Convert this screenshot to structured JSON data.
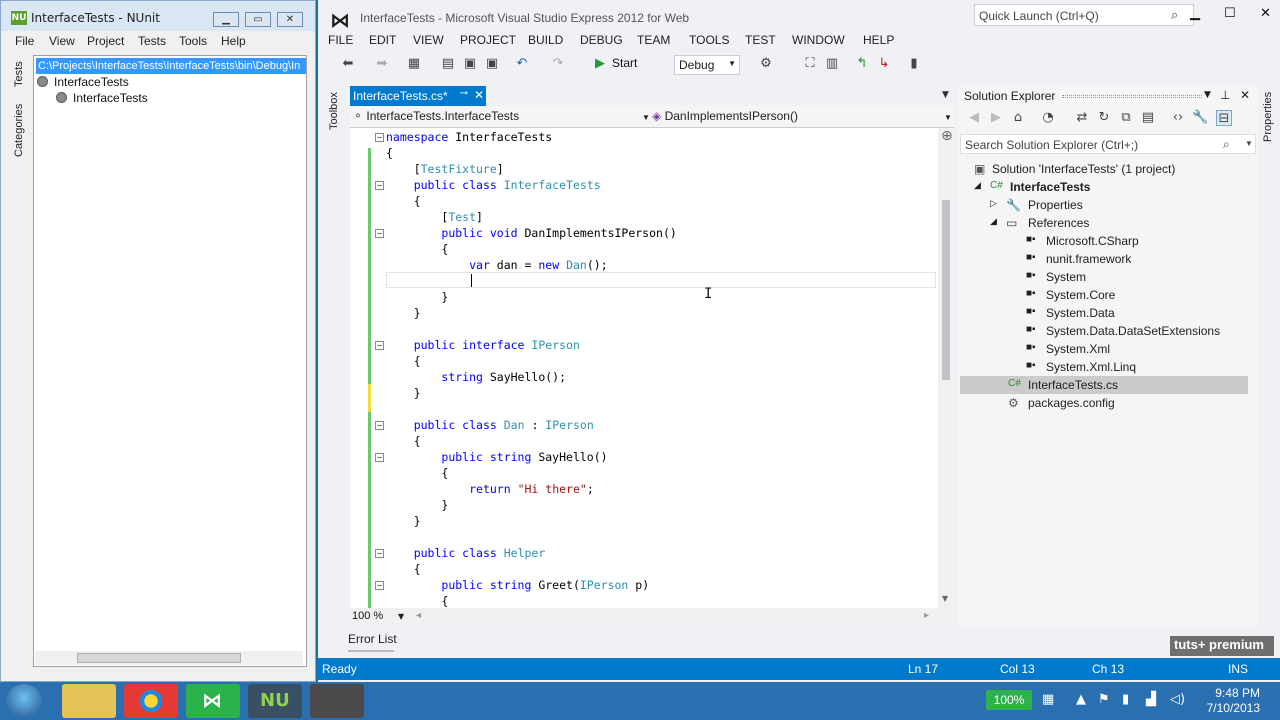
{
  "nunit": {
    "title": "InterfaceTests - NUnit",
    "logo": "NU",
    "menu": [
      "File",
      "View",
      "Project",
      "Tests",
      "Tools",
      "Help"
    ],
    "side_tabs": [
      "Tests",
      "Categories"
    ],
    "path": "C:\\Projects\\InterfaceTests\\InterfaceTests\\bin\\Debug\\In",
    "tree": [
      "InterfaceTests",
      "InterfaceTests"
    ]
  },
  "vs": {
    "title": "InterfaceTests - Microsoft Visual Studio Express 2012 for Web",
    "quick_launch_placeholder": "Quick Launch (Ctrl+Q)",
    "menu": [
      "FILE",
      "EDIT",
      "VIEW",
      "PROJECT",
      "BUILD",
      "DEBUG",
      "TEAM",
      "TOOLS",
      "TEST",
      "WINDOW",
      "HELP"
    ],
    "toolbar": {
      "start_label": "Start",
      "config": "Debug"
    },
    "toolbox_label": "Toolbox",
    "properties_label": "Properties",
    "doc_tab": "InterfaceTests.cs*",
    "nav": {
      "type_combo": "InterfaceTests.InterfaceTests",
      "member_combo": "DanImplementsIPerson()"
    },
    "zoom": "100 %",
    "error_list": "Error List"
  },
  "solution_explorer": {
    "title": "Solution Explorer",
    "search_placeholder": "Search Solution Explorer (Ctrl+;)",
    "items": [
      {
        "label": "Solution 'InterfaceTests' (1 project)"
      },
      {
        "label": "InterfaceTests"
      },
      {
        "label": "Properties"
      },
      {
        "label": "References"
      },
      {
        "label": "Microsoft.CSharp"
      },
      {
        "label": "nunit.framework"
      },
      {
        "label": "System"
      },
      {
        "label": "System.Core"
      },
      {
        "label": "System.Data"
      },
      {
        "label": "System.Data.DataSetExtensions"
      },
      {
        "label": "System.Xml"
      },
      {
        "label": "System.Xml.Linq"
      },
      {
        "label": "InterfaceTests.cs"
      },
      {
        "label": "packages.config"
      }
    ]
  },
  "status": {
    "state": "Ready",
    "line": "Ln 17",
    "col": "Col 13",
    "ch": "Ch 13",
    "mode": "INS"
  },
  "watermark": "tuts+ premium",
  "taskbar": {
    "battery": "100%",
    "time": "9:48 PM",
    "date": "7/10/2013"
  },
  "colors": {
    "accent": "#007acc",
    "keyword": "#0000ff",
    "type": "#2b91af",
    "string": "#a31515"
  }
}
